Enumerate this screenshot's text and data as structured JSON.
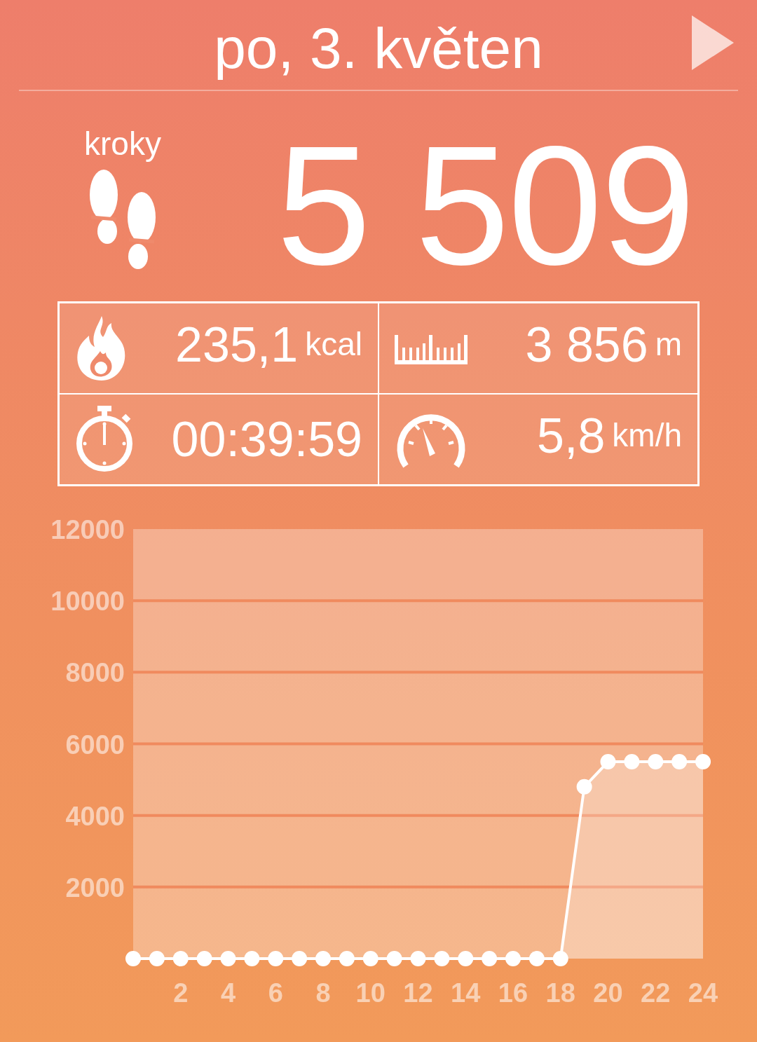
{
  "header": {
    "date": "po, 3. květen"
  },
  "steps": {
    "label": "kroky",
    "value": "5 509"
  },
  "stats": [
    {
      "kind": "calories",
      "value": "235,1",
      "unit": "kcal"
    },
    {
      "kind": "distance",
      "value": "3 856",
      "unit": "m"
    },
    {
      "kind": "duration",
      "value": "00:39:59"
    },
    {
      "kind": "speed",
      "value": "5,8",
      "unit": "km/h"
    }
  ],
  "chart": {
    "chart_data": {
      "type": "area",
      "x": [
        0,
        1,
        2,
        3,
        4,
        5,
        6,
        7,
        8,
        9,
        10,
        11,
        12,
        13,
        14,
        15,
        16,
        17,
        18,
        19,
        20,
        21,
        22,
        23,
        24
      ],
      "series": [
        {
          "color": "#ffffff",
          "values": [
            0,
            0,
            0,
            0,
            0,
            0,
            0,
            0,
            0,
            0,
            0,
            0,
            0,
            0,
            0,
            0,
            0,
            0,
            0,
            4800,
            5500,
            5500,
            5500,
            5500,
            5500
          ]
        }
      ],
      "grid": true,
      "xlim": [
        0,
        24
      ],
      "ylim": [
        0,
        12000
      ],
      "xticks": [
        2,
        4,
        6,
        8,
        10,
        12,
        14,
        16,
        18,
        20,
        22,
        24
      ],
      "yticks": [
        2000,
        4000,
        6000,
        8000,
        10000,
        12000
      ]
    }
  }
}
